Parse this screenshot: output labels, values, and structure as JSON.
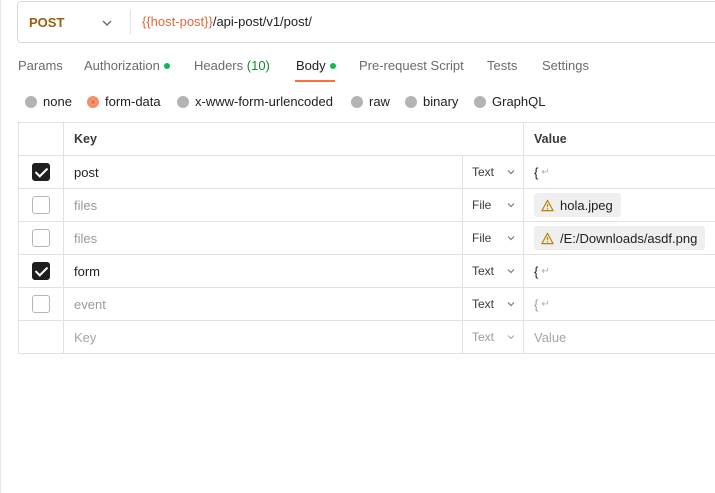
{
  "request": {
    "method": "POST",
    "url_var": "{{host-post}}",
    "url_path": "/api-post/v1/post/"
  },
  "tabs": [
    {
      "label": "Params"
    },
    {
      "label": "Authorization",
      "dot": true
    },
    {
      "label": "Headers",
      "count": "(10)"
    },
    {
      "label": "Body",
      "dot": true,
      "active": true
    },
    {
      "label": "Pre-request Script"
    },
    {
      "label": "Tests"
    },
    {
      "label": "Settings"
    }
  ],
  "body_types": [
    {
      "label": "none",
      "selected": false
    },
    {
      "label": "form-data",
      "selected": true
    },
    {
      "label": "x-www-form-urlencoded",
      "selected": false
    },
    {
      "label": "raw",
      "selected": false
    },
    {
      "label": "binary",
      "selected": false
    },
    {
      "label": "GraphQL",
      "selected": false
    }
  ],
  "table": {
    "headers": {
      "key": "Key",
      "value": "Value"
    },
    "rows": [
      {
        "checked": true,
        "key": "post",
        "highlight": true,
        "type": "Text",
        "value": "{",
        "value_kind": "text"
      },
      {
        "checked": false,
        "key": "files",
        "type": "File",
        "value": "hola.jpeg",
        "value_kind": "file"
      },
      {
        "checked": false,
        "key": "files",
        "type": "File",
        "value": "/E:/Downloads/asdf.png",
        "value_kind": "file"
      },
      {
        "checked": true,
        "key": "form",
        "highlight": true,
        "type": "Text",
        "value": "{",
        "value_kind": "text"
      },
      {
        "checked": false,
        "key": "event",
        "type": "Text",
        "value": "{",
        "value_kind": "text"
      }
    ],
    "new_row": {
      "key_placeholder": "Key",
      "type": "Text",
      "value_placeholder": "Value"
    }
  },
  "colors": {
    "accent": "#ff6c37",
    "method": "#9b5d0a",
    "variable": "#e0673a",
    "status_dot": "#0cbb52",
    "highlight": "#f5f500",
    "warning": "#b98100"
  },
  "icons": {
    "method_dropdown": "chevron-down-icon",
    "type_dropdown": "chevron-down-icon",
    "file_warning": "warning-icon",
    "newline": "return-icon"
  }
}
